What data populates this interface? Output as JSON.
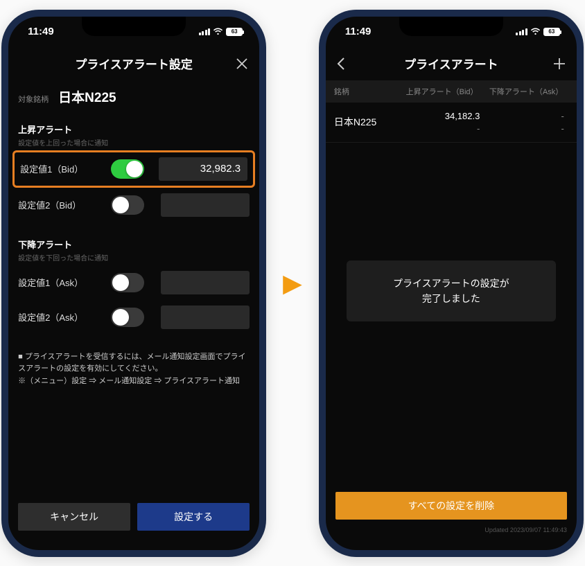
{
  "status": {
    "time": "11:49",
    "battery": "63"
  },
  "left": {
    "title": "プライスアラート設定",
    "symbol_label": "対象銘柄",
    "symbol_name": "日本N225",
    "up": {
      "title": "上昇アラート",
      "sub": "設定値を上回った場合に通知",
      "rows": [
        {
          "label": "設定値1（Bid）",
          "on": true,
          "value": "32,982.3"
        },
        {
          "label": "設定値2（Bid）",
          "on": false,
          "value": ""
        }
      ]
    },
    "down": {
      "title": "下降アラート",
      "sub": "設定値を下回った場合に通知",
      "rows": [
        {
          "label": "設定値1（Ask）",
          "on": false,
          "value": ""
        },
        {
          "label": "設定値2（Ask）",
          "on": false,
          "value": ""
        }
      ]
    },
    "note_line1": "プライスアラートを受信するには、メール通知設定画面でプライスアラートの設定を有効にしてください。",
    "note_line2": "※（メニュー）設定 ⇒ メール通知設定 ⇒ プライスアラート通知",
    "cancel": "キャンセル",
    "submit": "設定する"
  },
  "right": {
    "title": "プライスアラート",
    "cols": {
      "c1": "銘柄",
      "c2": "上昇アラート（Bid）",
      "c3": "下降アラート（Ask）"
    },
    "row": {
      "name": "日本N225",
      "bid1": "34,182.3",
      "bid2": "-",
      "ask1": "-",
      "ask2": "-"
    },
    "toast": "プライスアラートの設定が\n完了しました",
    "delete": "すべての設定を削除",
    "updated": "Updated 2023/09/07 11:49:43"
  }
}
